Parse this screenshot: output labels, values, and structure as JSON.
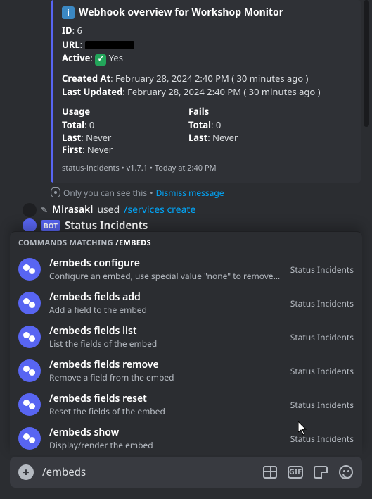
{
  "embed": {
    "title": "Webhook overview for Workshop Monitor",
    "id_label": "ID",
    "id_value": "6",
    "url_label": "URL",
    "active_label": "Active",
    "active_value": "Yes",
    "created_label": "Created At",
    "created_value": "February 28, 2024 2:40 PM",
    "created_rel": "( 30 minutes ago )",
    "updated_label": "Last Updated",
    "updated_value": "February 28, 2024 2:40 PM",
    "updated_rel": "( 30 minutes ago )",
    "usage": {
      "title": "Usage",
      "total_label": "Total",
      "total_value": "0",
      "last_label": "Last",
      "last_value": "Never",
      "first_label": "First",
      "first_value": "Never"
    },
    "fails": {
      "title": "Fails",
      "total_label": "Total",
      "total_value": "0",
      "last_label": "Last",
      "last_value": "Never"
    },
    "footer_app": "status-incidents",
    "footer_ver": "v1.7.1",
    "footer_time": "Today at 2:40 PM"
  },
  "ephemeral": {
    "text": "Only you can see this",
    "dismiss": "Dismiss message"
  },
  "reply": {
    "user": "Mirasaki",
    "verb": "used",
    "command": "/services create"
  },
  "bot": {
    "tag": "BOT",
    "name": "Status Incidents"
  },
  "autocomplete": {
    "header_prefix": "COMMANDS MATCHING",
    "header_match": "/embeds",
    "source": "Status Incidents",
    "items": [
      {
        "name": "/embeds configure",
        "desc": "Configure an embed, use special value \"none\" to remove existing field..."
      },
      {
        "name": "/embeds fields add",
        "desc": "Add a field to the embed"
      },
      {
        "name": "/embeds fields list",
        "desc": "List the fields of the embed"
      },
      {
        "name": "/embeds fields remove",
        "desc": "Remove a field from the embed"
      },
      {
        "name": "/embeds fields reset",
        "desc": "Reset the fields of the embed"
      },
      {
        "name": "/embeds show",
        "desc": "Display/render the embed"
      }
    ]
  },
  "input": {
    "value": "/embeds",
    "gif_label": "GIF"
  }
}
